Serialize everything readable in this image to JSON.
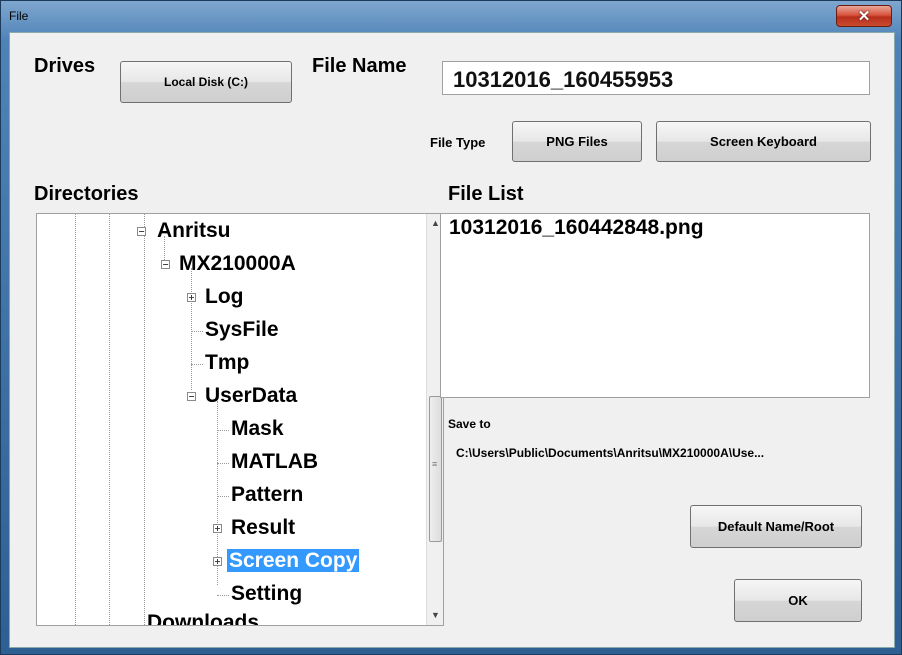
{
  "window": {
    "title": "File",
    "close_glyph": "✕"
  },
  "drives": {
    "label": "Drives",
    "button": "Local Disk (C:)"
  },
  "filename": {
    "label": "File Name",
    "value": "10312016_160455953"
  },
  "filetype": {
    "label": "File Type",
    "button": "PNG Files"
  },
  "keyboard_button": "Screen Keyboard",
  "directories": {
    "label": "Directories",
    "items": [
      {
        "label": "Anritsu",
        "toggle": "−"
      },
      {
        "label": "MX210000A",
        "toggle": "−"
      },
      {
        "label": "Log",
        "toggle": "+"
      },
      {
        "label": "SysFile"
      },
      {
        "label": "Tmp"
      },
      {
        "label": "UserData",
        "toggle": "−"
      },
      {
        "label": "Mask"
      },
      {
        "label": "MATLAB"
      },
      {
        "label": "Pattern"
      },
      {
        "label": "Result",
        "toggle": "+"
      },
      {
        "label": "Screen Copy",
        "toggle": "+",
        "selected": true
      },
      {
        "label": "Setting"
      },
      {
        "label": "Downloads"
      }
    ]
  },
  "filelist": {
    "label": "File List",
    "items": [
      "10312016_160442848.png"
    ]
  },
  "save_to": {
    "label": "Save to",
    "path": "C:\\Users\\Public\\Documents\\Anritsu\\MX210000A\\Use..."
  },
  "buttons": {
    "default_name": "Default Name/Root",
    "ok": "OK"
  },
  "colors": {
    "selection": "#3399ff",
    "close": "#c94b2f"
  }
}
